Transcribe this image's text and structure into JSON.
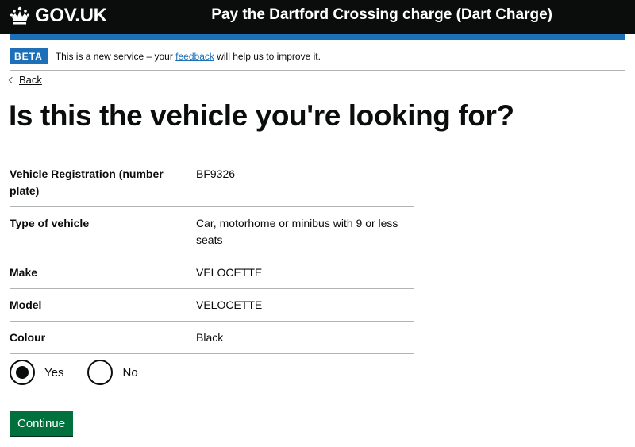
{
  "header": {
    "logo_text": "GOV.UK",
    "service_name": "Pay the Dartford Crossing charge (Dart Charge)"
  },
  "phase_banner": {
    "tag": "BETA",
    "text_before": "This is a new service – your ",
    "link": "feedback",
    "text_after": " will help us to improve it."
  },
  "back_link": "Back",
  "page_title": "Is this the vehicle you're looking for?",
  "summary": [
    {
      "key": "Vehicle Registration (number plate)",
      "value": "BF9326"
    },
    {
      "key": "Type of vehicle",
      "value": "Car, motorhome or minibus with 9 or less seats"
    },
    {
      "key": "Make",
      "value": "VELOCETTE"
    },
    {
      "key": "Model",
      "value": "VELOCETTE"
    },
    {
      "key": "Colour",
      "value": "Black"
    }
  ],
  "radios": {
    "options": [
      {
        "label": "Yes",
        "checked": true
      },
      {
        "label": "No",
        "checked": false
      }
    ]
  },
  "continue_button": "Continue",
  "colors": {
    "header": "#0b0c0c",
    "brand_blue": "#1d70b8",
    "button_green": "#00703c"
  }
}
